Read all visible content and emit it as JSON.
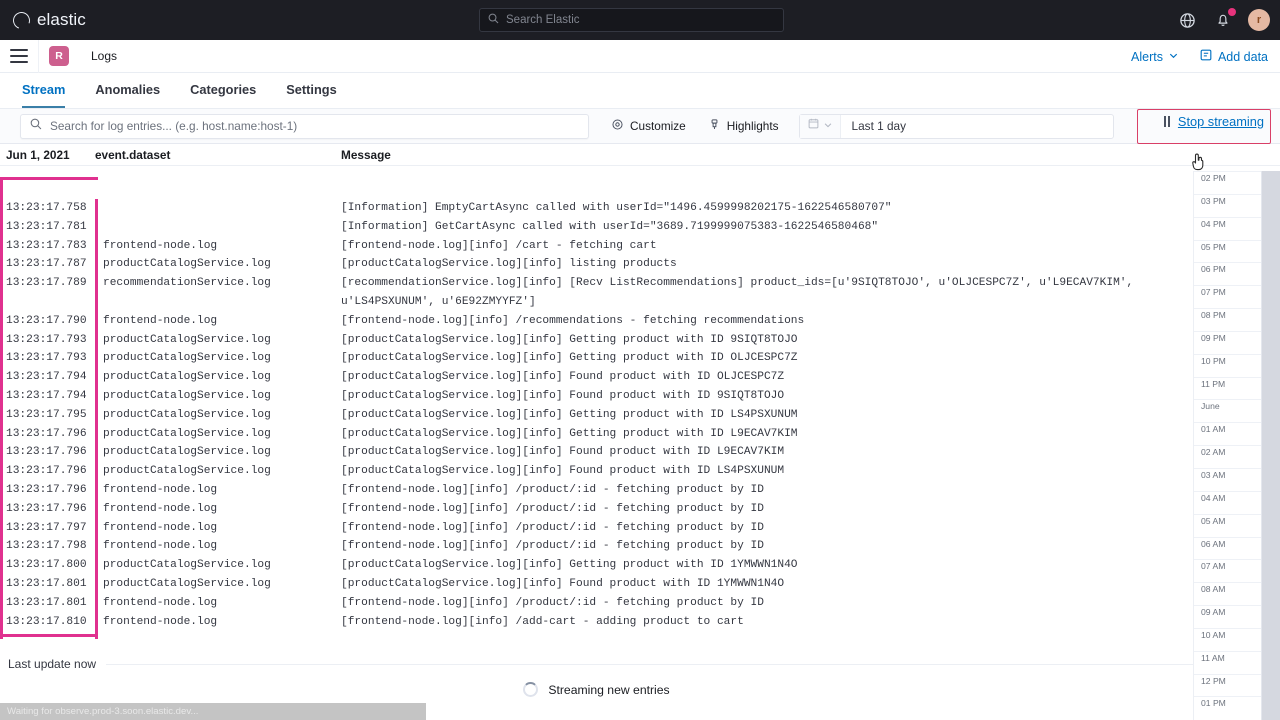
{
  "global_nav": {
    "brand": "elastic",
    "search_placeholder": "Search Elastic",
    "search_icon": "search-icon",
    "help_icon": "help-globe-icon",
    "notifications_icon": "notifications-bell-icon",
    "avatar_initial": "r"
  },
  "app_header": {
    "menu_icon": "hamburger-menu-icon",
    "space_initial": "R",
    "title": "Logs",
    "alerts_label": "Alerts",
    "alerts_chevron_icon": "chevron-down-icon",
    "add_data_label": "Add data",
    "add_data_icon": "add-data-icon"
  },
  "tabs": [
    {
      "label": "Stream",
      "active": true
    },
    {
      "label": "Anomalies",
      "active": false
    },
    {
      "label": "Categories",
      "active": false
    },
    {
      "label": "Settings",
      "active": false
    }
  ],
  "toolbar": {
    "search_placeholder": "Search for log entries... (e.g. host.name:host-1)",
    "search_icon": "search-icon",
    "customize_label": "Customize",
    "customize_icon": "customize-gear-icon",
    "highlights_label": "Highlights",
    "highlights_icon": "highlights-marker-icon",
    "time_range_value": "Last 1 day",
    "calendar_icon": "calendar-icon",
    "quick_select_chevron_icon": "chevron-down-icon",
    "stop_streaming_label": "Stop streaming",
    "pause_icon": "pause-icon",
    "highlight_color": "#d93f67"
  },
  "columns": {
    "timestamp_header": "Jun 1, 2021",
    "dataset_header": "event.dataset",
    "message_header": "Message"
  },
  "log_rows": [
    {
      "time": "13:23:17.758",
      "dataset": "",
      "message": "[Information] EmptyCartAsync called with userId=\"1496.4599998202175-1622546580707\""
    },
    {
      "time": "13:23:17.781",
      "dataset": "",
      "message": "[Information] GetCartAsync called with userId=\"3689.7199999075383-1622546580468\""
    },
    {
      "time": "13:23:17.783",
      "dataset": "frontend-node.log",
      "message": "[frontend-node.log][info] /cart - fetching cart"
    },
    {
      "time": "13:23:17.787",
      "dataset": "productCatalogService.log",
      "message": "[productCatalogService.log][info] listing products"
    },
    {
      "time": "13:23:17.789",
      "dataset": "recommendationService.log",
      "message": "[recommendationService.log][info] [Recv ListRecommendations] product_ids=[u'9SIQT8TOJO', u'OLJCESPC7Z', u'L9ECAV7KIM', u'LS4PSXUNUM', u'6E92ZMYYFZ']"
    },
    {
      "time": "13:23:17.790",
      "dataset": "frontend-node.log",
      "message": "[frontend-node.log][info] /recommendations - fetching recommendations"
    },
    {
      "time": "13:23:17.793",
      "dataset": "productCatalogService.log",
      "message": "[productCatalogService.log][info] Getting product with ID 9SIQT8TOJO"
    },
    {
      "time": "13:23:17.793",
      "dataset": "productCatalogService.log",
      "message": "[productCatalogService.log][info] Getting product with ID OLJCESPC7Z"
    },
    {
      "time": "13:23:17.794",
      "dataset": "productCatalogService.log",
      "message": "[productCatalogService.log][info] Found product with ID OLJCESPC7Z"
    },
    {
      "time": "13:23:17.794",
      "dataset": "productCatalogService.log",
      "message": "[productCatalogService.log][info] Found product with ID 9SIQT8TOJO"
    },
    {
      "time": "13:23:17.795",
      "dataset": "productCatalogService.log",
      "message": "[productCatalogService.log][info] Getting product with ID LS4PSXUNUM"
    },
    {
      "time": "13:23:17.796",
      "dataset": "productCatalogService.log",
      "message": "[productCatalogService.log][info] Getting product with ID L9ECAV7KIM"
    },
    {
      "time": "13:23:17.796",
      "dataset": "productCatalogService.log",
      "message": "[productCatalogService.log][info] Found product with ID L9ECAV7KIM"
    },
    {
      "time": "13:23:17.796",
      "dataset": "productCatalogService.log",
      "message": "[productCatalogService.log][info] Found product with ID LS4PSXUNUM"
    },
    {
      "time": "13:23:17.796",
      "dataset": "frontend-node.log",
      "message": "[frontend-node.log][info] /product/:id - fetching product by ID"
    },
    {
      "time": "13:23:17.796",
      "dataset": "frontend-node.log",
      "message": "[frontend-node.log][info] /product/:id - fetching product by ID"
    },
    {
      "time": "13:23:17.797",
      "dataset": "frontend-node.log",
      "message": "[frontend-node.log][info] /product/:id - fetching product by ID"
    },
    {
      "time": "13:23:17.798",
      "dataset": "frontend-node.log",
      "message": "[frontend-node.log][info] /product/:id - fetching product by ID"
    },
    {
      "time": "13:23:17.800",
      "dataset": "productCatalogService.log",
      "message": "[productCatalogService.log][info] Getting product with ID 1YMWWN1N4O"
    },
    {
      "time": "13:23:17.801",
      "dataset": "productCatalogService.log",
      "message": "[productCatalogService.log][info] Found product with ID 1YMWWN1N4O"
    },
    {
      "time": "13:23:17.801",
      "dataset": "frontend-node.log",
      "message": "[frontend-node.log][info] /product/:id - fetching product by ID"
    },
    {
      "time": "13:23:17.810",
      "dataset": "frontend-node.log",
      "message": "[frontend-node.log][info] /add-cart - adding product to cart"
    }
  ],
  "minimap": {
    "ticks": [
      "02 PM",
      "03 PM",
      "04 PM",
      "05 PM",
      "06 PM",
      "07 PM",
      "08 PM",
      "09 PM",
      "10 PM",
      "11 PM",
      "June",
      "01 AM",
      "02 AM",
      "03 AM",
      "04 AM",
      "05 AM",
      "06 AM",
      "07 AM",
      "08 AM",
      "09 AM",
      "10 AM",
      "11 AM",
      "12 PM",
      "01 PM"
    ]
  },
  "footer": {
    "last_update_label": "Last update now",
    "streaming_label": "Streaming new entries",
    "browser_status": "Waiting for observe.prod-3.soon.elastic.dev..."
  }
}
